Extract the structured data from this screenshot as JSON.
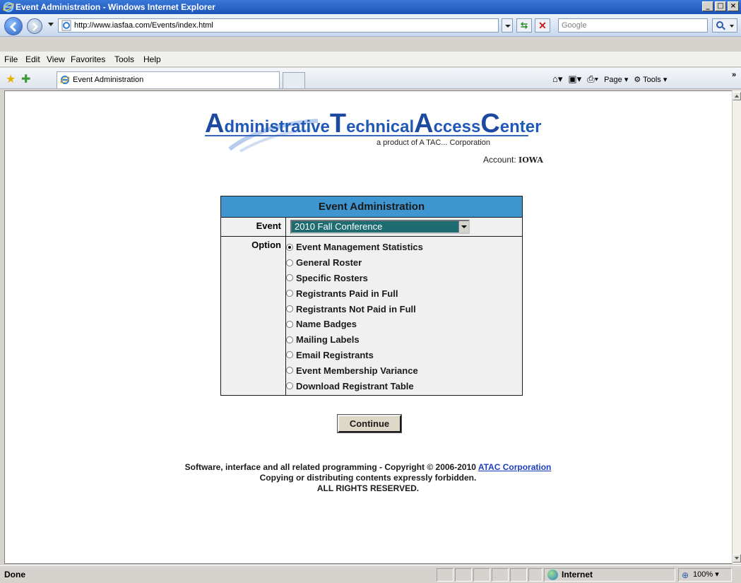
{
  "window": {
    "title": "Event Administration - Windows Internet Explorer",
    "minimize": "_",
    "maximize": "□",
    "close": "×"
  },
  "navbar": {
    "url": "http://www.iasfaa.com/Events/index.html",
    "search_placeholder": "Google"
  },
  "menu": {
    "items": [
      "File",
      "Edit",
      "View",
      "Favorites",
      "Tools",
      "Help"
    ]
  },
  "tabs": {
    "active_label": "Event Administration"
  },
  "commandbar": {
    "page_label": "Page",
    "tools_label": "Tools",
    "more": "»"
  },
  "logo": {
    "letter_a": "A",
    "word_a": "dministrative",
    "letter_t": "T",
    "word_t": "echnical",
    "letter_a2": "A",
    "word_a2": "ccess",
    "letter_c": "C",
    "word_c": "enter",
    "tagline": "a product of A TAC... Corporation"
  },
  "account": {
    "label": "Account:",
    "value": "IOWA"
  },
  "admin": {
    "title": "Event Administration",
    "event_label": "Event",
    "event_selected": "2010 Fall Conference",
    "option_label": "Option",
    "options": [
      "Event Management Statistics",
      "General Roster",
      "Specific Rosters",
      "Registrants Paid in Full",
      "Registrants Not Paid in Full",
      "Name Badges",
      "Mailing Labels",
      "Email Registrants",
      "Event Membership Variance",
      "Download Registrant Table"
    ],
    "selected_index": 0,
    "continue_label": "Continue"
  },
  "footer": {
    "line1": "Software, interface and all related programming - Copyright © 2006-2010",
    "link": "ATAC Corporation",
    "line2": "Copying or distributing contents expressly forbidden.",
    "line3": "ALL RIGHTS RESERVED."
  },
  "status": {
    "text": "Done",
    "zone": "Internet",
    "zoom": "100%"
  }
}
